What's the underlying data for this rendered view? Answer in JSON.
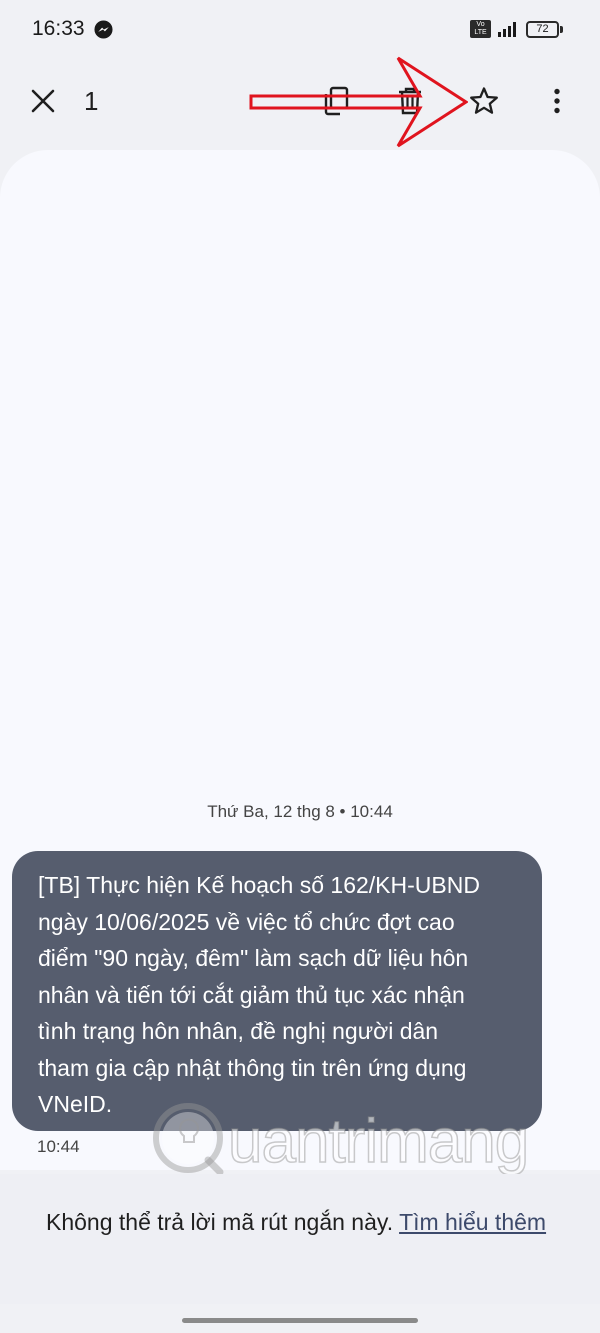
{
  "status_bar": {
    "time": "16:33",
    "battery": "72",
    "icons": [
      "messenger-icon",
      "volte-icon",
      "signal-icon",
      "battery-icon"
    ]
  },
  "toolbar": {
    "selected_count": "1",
    "icons": [
      "close-icon",
      "copy-icon",
      "delete-icon",
      "star-icon",
      "more-vert-icon"
    ]
  },
  "thread": {
    "date_separator": "Thứ Ba, 12 thg 8 • 10:44",
    "message": {
      "lines": [
        "[TB] Thực hiện Kế hoạch số 162/KH-UBND",
        "ngày 10/06/2025 về việc tổ chức đợt cao",
        "điểm \"90 ngày, đêm\" làm sạch dữ liệu hôn",
        "nhân và tiến tới cắt giảm thủ tục xác nhận",
        "tình trạng hôn nhân, đề nghị người dân",
        "tham gia cập nhật thông tin trên ứng dụng",
        "VNeID."
      ],
      "time": "10:44"
    }
  },
  "footer": {
    "notice": "Không thể trả lời mã rút ngắn này.",
    "link": "Tìm hiểu thêm"
  },
  "watermark": {
    "text": "uantrimang"
  },
  "colors": {
    "bubble": "#565d6e",
    "thread_bg": "#f8f9fe",
    "annotation_arrow": "#e0141e",
    "link": "#3d4a6b"
  }
}
